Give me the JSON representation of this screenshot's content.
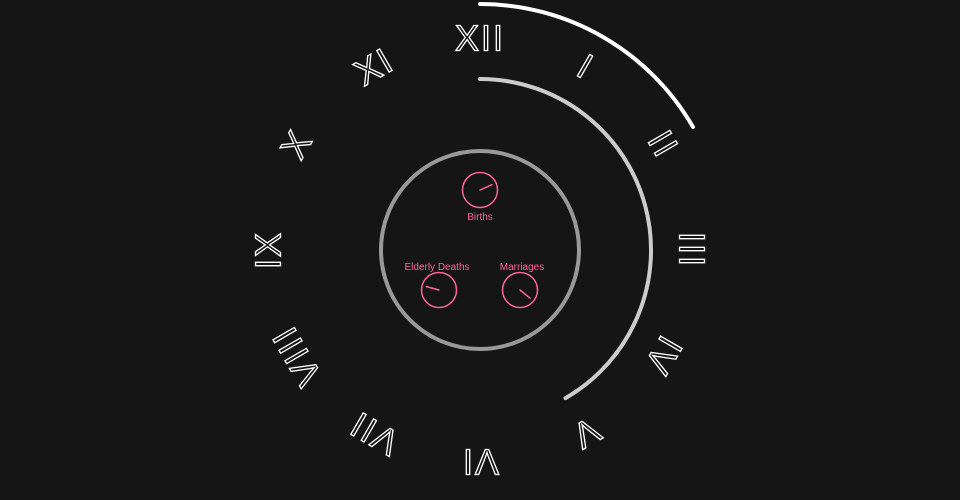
{
  "clock": {
    "numerals": [
      "XII",
      "I",
      "II",
      "III",
      "IV",
      "V",
      "VI",
      "VII",
      "VIII",
      "IX",
      "X",
      "XI"
    ],
    "numeral_color": "#ffffff",
    "outer_arc_color": "#ffffff",
    "inner_arc_color": "#cccccc",
    "face_ring_color": "#999999",
    "dial_color": "#ff6699",
    "outer_arc_end_hours": 2,
    "inner_arc_end_hours": 5
  },
  "dials": [
    {
      "label": "Births",
      "hand_hours": 2.2
    },
    {
      "label": "Elderly Deaths",
      "hand_hours": 9.5
    },
    {
      "label": "Marriages",
      "hand_hours": 4.3
    }
  ]
}
